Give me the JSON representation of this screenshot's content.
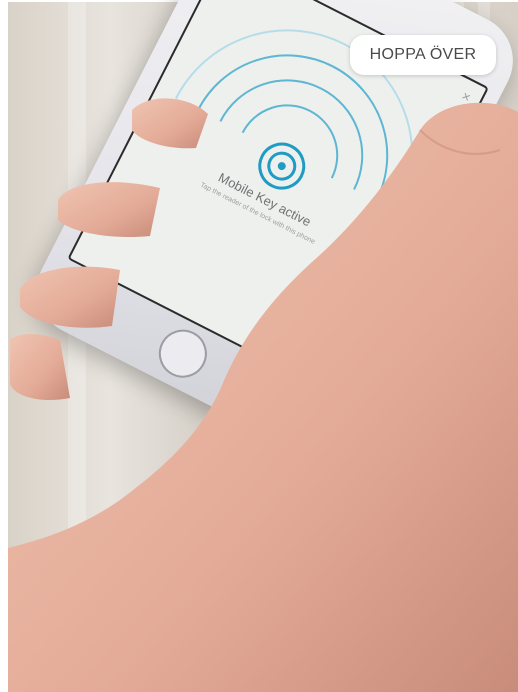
{
  "skip": {
    "label": "HOPPA ÖVER"
  },
  "phone_screen": {
    "title": "Mobile Key active",
    "subtitle": "Tap the reader of the lock with this phone",
    "close_glyph": "×",
    "icon": "nfc-key-icon"
  },
  "colors": {
    "arc": "#5db6d2",
    "accent": "#1f9bc4",
    "skin": "#e8b8a6"
  }
}
